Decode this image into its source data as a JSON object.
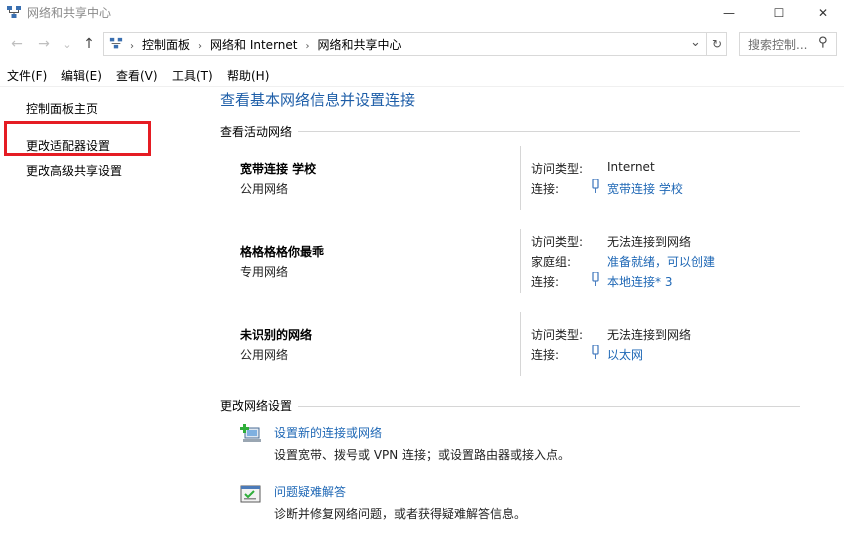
{
  "window": {
    "title": "网络和共享中心",
    "minimize_glyph": "—",
    "maximize_glyph": "☐",
    "close_glyph": "✕"
  },
  "nav": {
    "back_glyph": "←",
    "forward_glyph": "→",
    "recent_glyph": "⌄",
    "up_glyph": "↑",
    "breadcrumbs": [
      "控制面板",
      "网络和 Internet",
      "网络和共享中心"
    ],
    "breadcrumb_sep": "›",
    "dropdown_glyph": "⌄",
    "refresh_glyph": "↻",
    "search_placeholder": "搜索控制...",
    "search_glyph": "⚲"
  },
  "menu": [
    "文件(F)",
    "编辑(E)",
    "查看(V)",
    "工具(T)",
    "帮助(H)"
  ],
  "sidebar": {
    "items": [
      "控制面板主页",
      "更改适配器设置",
      "更改高级共享设置"
    ]
  },
  "main": {
    "title": "查看基本网络信息并设置连接",
    "active_header": "查看活动网络",
    "networks": [
      {
        "name": "宽带连接  学校",
        "type": "公用网络",
        "rows": [
          {
            "label": "访问类型:",
            "value": "Internet",
            "link": false
          },
          {
            "label": "连接:",
            "value": "宽带连接  学校",
            "link": true
          }
        ]
      },
      {
        "name": "格格格格你最乖",
        "type": "专用网络",
        "rows": [
          {
            "label": "访问类型:",
            "value": "无法连接到网络",
            "link": false
          },
          {
            "label": "家庭组:",
            "value": "准备就绪，可以创建",
            "link": true
          },
          {
            "label": "连接:",
            "value": "本地连接* 3",
            "link": true
          }
        ]
      },
      {
        "name": "未识别的网络",
        "type": "公用网络",
        "rows": [
          {
            "label": "访问类型:",
            "value": "无法连接到网络",
            "link": false
          },
          {
            "label": "连接:",
            "value": "以太网",
            "link": true
          }
        ]
      }
    ],
    "change_header": "更改网络设置",
    "tasks": [
      {
        "title": "设置新的连接或网络",
        "desc": "设置宽带、拨号或 VPN 连接；或设置路由器或接入点。",
        "icon": "new-connection-icon"
      },
      {
        "title": "问题疑难解答",
        "desc": "诊断并修复网络问题，或者获得疑难解答信息。",
        "icon": "troubleshoot-icon"
      }
    ]
  },
  "colors": {
    "link": "#1e67b5",
    "title": "#1e5ea8",
    "highlight": "#e51c23"
  }
}
